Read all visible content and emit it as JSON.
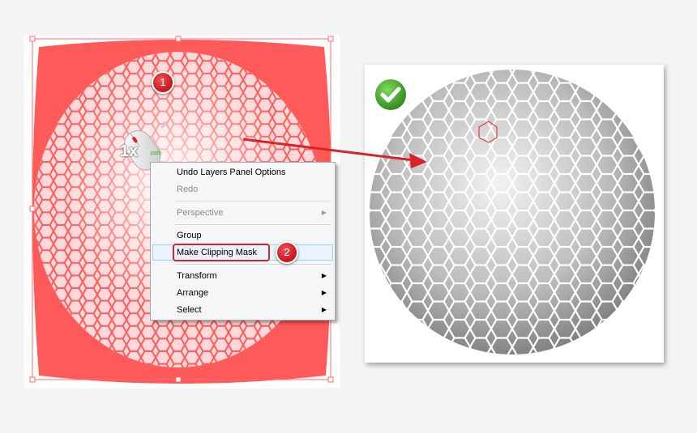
{
  "steps": {
    "first": "1",
    "second": "2"
  },
  "mouse": {
    "zoom_label": "1x",
    "tiny_label": "path"
  },
  "context_menu": {
    "items": [
      {
        "label": "Undo Layers Panel Options",
        "enabled": true,
        "submenu": false
      },
      {
        "label": "Redo",
        "enabled": false,
        "submenu": false
      },
      {
        "label": "Perspective",
        "enabled": false,
        "submenu": true
      },
      {
        "label": "Group",
        "enabled": true,
        "submenu": false
      },
      {
        "label": "Make Clipping Mask",
        "enabled": true,
        "submenu": false,
        "highlighted": true
      },
      {
        "label": "Transform",
        "enabled": true,
        "submenu": true
      },
      {
        "label": "Arrange",
        "enabled": true,
        "submenu": true
      },
      {
        "label": "Select",
        "enabled": true,
        "submenu": true
      }
    ]
  },
  "icons": {
    "checkmark": "check-circle-icon",
    "mouse": "mouse-icon",
    "submenu": "chevron-right-icon"
  },
  "colors": {
    "selection": "#ff5a5a",
    "highlight": "#d8232a",
    "check": "#3a9d23"
  }
}
